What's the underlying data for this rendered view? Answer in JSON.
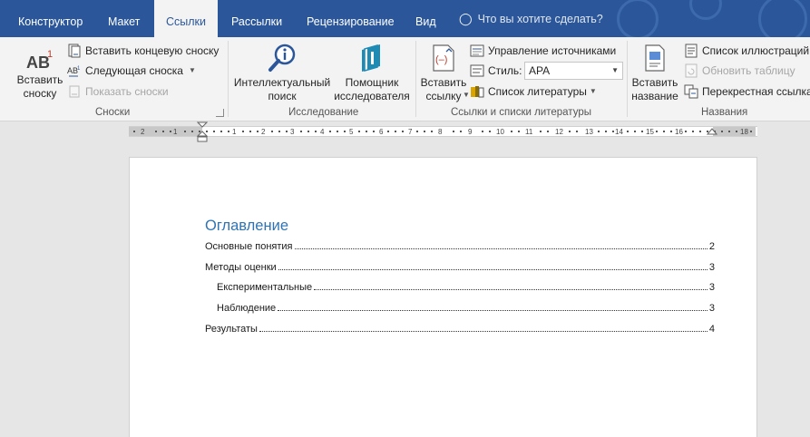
{
  "tabs": [
    {
      "label": "Конструктор",
      "active": false
    },
    {
      "label": "Макет",
      "active": false
    },
    {
      "label": "Ссылки",
      "active": true
    },
    {
      "label": "Рассылки",
      "active": false
    },
    {
      "label": "Рецензирование",
      "active": false
    },
    {
      "label": "Вид",
      "active": false
    }
  ],
  "tell_me": "Что вы хотите сделать?",
  "ribbon": {
    "footnotes": {
      "insert_footnote": "Вставить\nсноску",
      "insert_endnote": "Вставить концевую сноску",
      "next_footnote": "Следующая сноска",
      "show_notes": "Показать сноски",
      "group_label": "Сноски"
    },
    "research": {
      "smart_lookup": "Интеллектуальный\nпоиск",
      "researcher": "Помощник\nисследователя",
      "group_label": "Исследование"
    },
    "citations": {
      "insert_citation": "Вставить\nссылку",
      "manage_sources": "Управление источниками",
      "style_label": "Стиль:",
      "style_value": "APA",
      "bibliography": "Список литературы",
      "group_label": "Ссылки и списки литературы"
    },
    "captions": {
      "insert_caption": "Вставить\nназвание",
      "table_of_figures": "Список иллюстраций",
      "update_table": "Обновить таблицу",
      "cross_reference": "Перекрестная ссылка",
      "group_label": "Названия"
    }
  },
  "ruler_labels": [
    "2",
    "1",
    "1",
    "2",
    "3",
    "4",
    "5",
    "6",
    "7",
    "8",
    "9",
    "10",
    "11",
    "12",
    "13",
    "14",
    "15",
    "16",
    "18"
  ],
  "document": {
    "toc_title": "Оглавление",
    "entries": [
      {
        "text": "Основные понятия",
        "page": "2",
        "level": 1
      },
      {
        "text": "Методы оценки",
        "page": "3",
        "level": 1
      },
      {
        "text": "Експериментальные",
        "page": "3",
        "level": 2
      },
      {
        "text": "Наблюдение",
        "page": "3",
        "level": 2
      },
      {
        "text": "Результаты",
        "page": "4",
        "level": 1
      }
    ]
  },
  "colors": {
    "tab_bar": "#2b579a",
    "ribbon": "#f3f3f3",
    "toc_title": "#2e74b5"
  }
}
